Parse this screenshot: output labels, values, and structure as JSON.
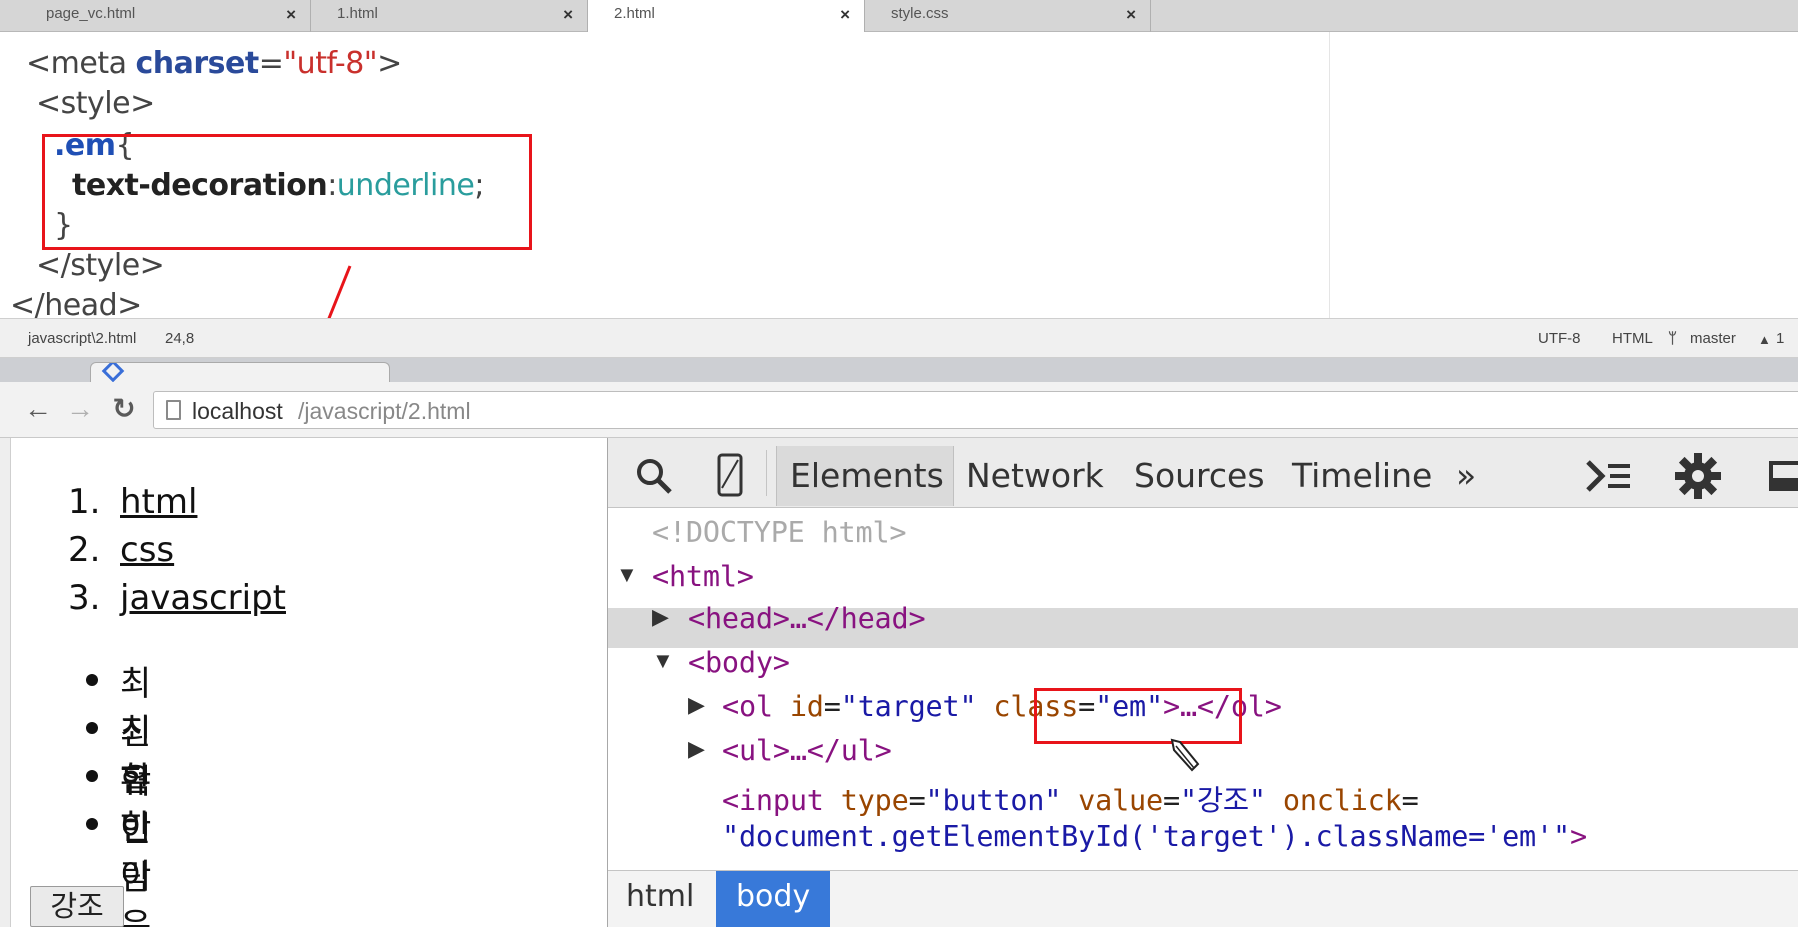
{
  "editor": {
    "tabs": [
      {
        "label": "page_vc.html"
      },
      {
        "label": "1.html"
      },
      {
        "label": "2.html"
      },
      {
        "label": "style.css"
      }
    ],
    "close_glyph": "×",
    "code": {
      "meta_open": "<meta ",
      "meta_attr": "charset",
      "meta_eq": "=",
      "meta_val": "\"utf-8\"",
      "meta_close": ">",
      "style_open": "<style>",
      "selector": ".em",
      "brace_open": "{",
      "property": "text-decoration",
      "colon": ":",
      "value": "underline",
      "semicolon": ";",
      "brace_close": "}",
      "style_close": "</style>",
      "head_close": "</head>"
    },
    "status": {
      "path": "javascript\\2.html",
      "position": "24,8",
      "encoding": "UTF-8",
      "syntax": "HTML",
      "branch": "master",
      "commits": "1"
    }
  },
  "browser": {
    "url_host": "localhost",
    "url_path": "/javascript/2.html",
    "nav": {
      "back": "←",
      "forward": "→",
      "reload": "↻"
    },
    "ordered_list": [
      {
        "num": "1.",
        "text": "html"
      },
      {
        "num": "2.",
        "text": "css"
      },
      {
        "num": "3.",
        "text": "javascript"
      }
    ],
    "unordered_list": [
      "최진혁",
      "최유빈",
      "한이람",
      "한이은"
    ],
    "button_label": "강조"
  },
  "devtools": {
    "tabs": [
      "Elements",
      "Network",
      "Sources",
      "Timeline"
    ],
    "more": "»",
    "dom": {
      "doctype": "<!DOCTYPE html>",
      "html_open": "<html>",
      "head_collapsed": "<head>…</head>",
      "body_open": "<body>",
      "ol_tag": "<ol ",
      "ol_id_attr": "id",
      "ol_id_val": "\"target\"",
      "ol_class_attr": "class",
      "ol_class_val": "\"em\"",
      "ol_rest": ">…</ol>",
      "ul_collapsed": "<ul>…</ul>",
      "input_tag": "<input ",
      "input_type_attr": "type",
      "input_type_val": "\"button\"",
      "input_value_attr": "value",
      "input_value_val": "\"강조\"",
      "input_onclick_attr": "onclick",
      "input_onclick_val": "\"document.getElementById('target').className='em'\"",
      "input_end": ">"
    },
    "breadcrumbs": [
      "html",
      "body"
    ]
  },
  "colors": {
    "annotation": "#e8141a",
    "devtools_accent": "#3879d9"
  }
}
